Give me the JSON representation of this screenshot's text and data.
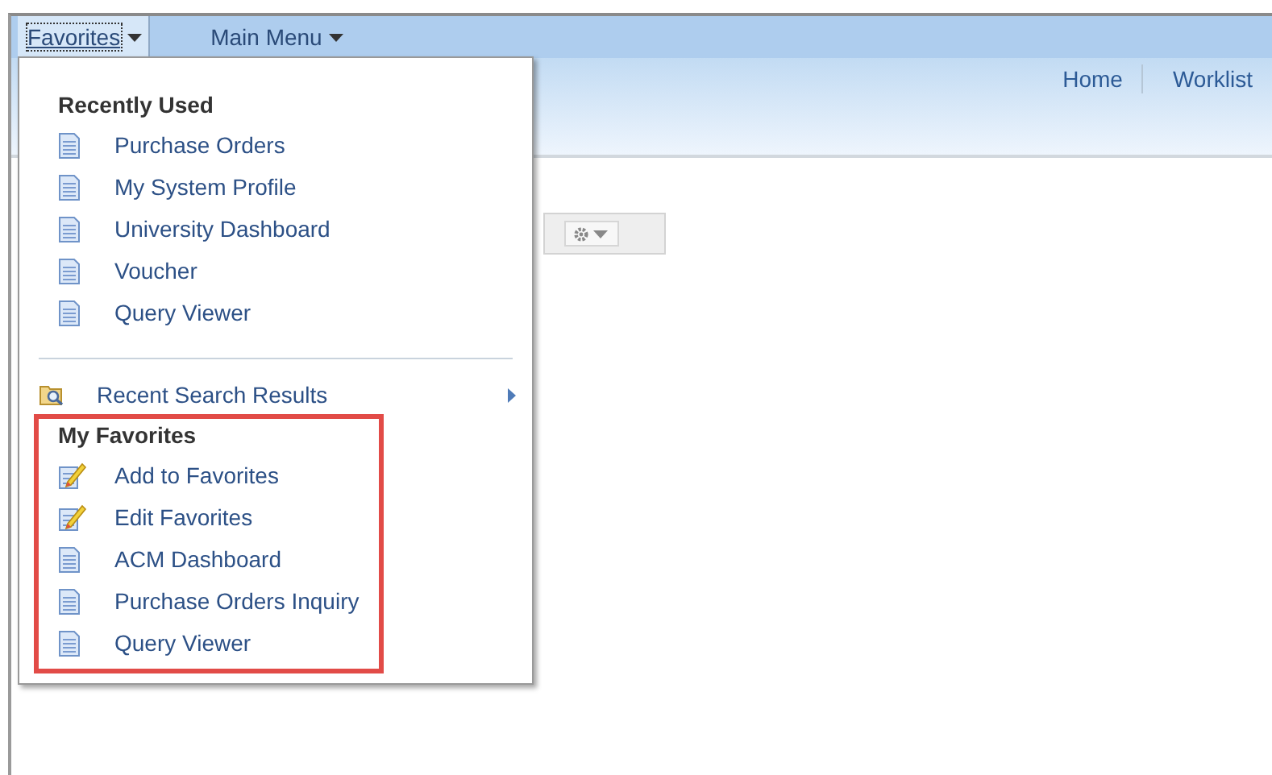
{
  "menu_bar": {
    "tabs": [
      {
        "label": "Favorites",
        "selected": true
      },
      {
        "label": "Main Menu",
        "selected": false
      }
    ]
  },
  "header": {
    "links": [
      "Home",
      "Worklist"
    ]
  },
  "favorites_menu": {
    "recently_used": {
      "title": "Recently Used",
      "items": [
        {
          "label": "Purchase Orders",
          "kind": "page"
        },
        {
          "label": "My System Profile",
          "kind": "page"
        },
        {
          "label": "University Dashboard",
          "kind": "page"
        },
        {
          "label": "Voucher",
          "kind": "page"
        },
        {
          "label": "Query Viewer",
          "kind": "page"
        }
      ]
    },
    "recent_search_results": {
      "label": "Recent Search Results"
    },
    "my_favorites": {
      "title": "My Favorites",
      "highlighted": true,
      "items": [
        {
          "label": "Add to Favorites",
          "kind": "edit"
        },
        {
          "label": "Edit Favorites",
          "kind": "edit"
        },
        {
          "label": "ACM Dashboard",
          "kind": "page"
        },
        {
          "label": "Purchase Orders Inquiry",
          "kind": "page"
        },
        {
          "label": "Query Viewer",
          "kind": "page"
        }
      ]
    }
  }
}
